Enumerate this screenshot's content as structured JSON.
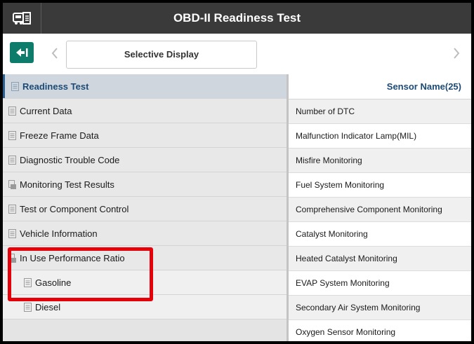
{
  "header": {
    "title": "OBD-II Readiness Test",
    "logo_icon": "car-document-icon"
  },
  "toolbar": {
    "exit_icon": "exit-arrow-icon",
    "prev_icon": "chevron-left-icon",
    "next_icon": "chevron-right-icon",
    "selective_display_label": "Selective Display"
  },
  "menu": {
    "items": [
      {
        "label": "Readiness Test",
        "icon": "document-icon",
        "active": true
      },
      {
        "label": "Current Data",
        "icon": "document-icon"
      },
      {
        "label": "Freeze Frame Data",
        "icon": "document-icon"
      },
      {
        "label": "Diagnostic Trouble Code",
        "icon": "document-icon"
      },
      {
        "label": "Monitoring Test Results",
        "icon": "folder-document-icon"
      },
      {
        "label": "Test or Component Control",
        "icon": "document-icon"
      },
      {
        "label": "Vehicle Information",
        "icon": "document-icon"
      },
      {
        "label": "In Use Performance Ratio",
        "icon": "folder-document-icon"
      },
      {
        "label": "Gasoline",
        "icon": "document-icon",
        "sub": true
      },
      {
        "label": "Diesel",
        "icon": "document-icon",
        "sub": true
      }
    ]
  },
  "sensors": {
    "header": "Sensor Name(25)",
    "rows": [
      "Number of DTC",
      "Malfunction Indicator Lamp(MIL)",
      "Misfire Monitoring",
      "Fuel System Monitoring",
      "Comprehensive Component Monitoring",
      "Catalyst Monitoring",
      "Heated Catalyst Monitoring",
      "EVAP System Monitoring",
      "Secondary Air System Monitoring",
      "Oxygen Sensor Monitoring"
    ]
  },
  "colors": {
    "header_bg": "#3a3a3a",
    "exit_button": "#0d7c6a",
    "active_text": "#1c4a76",
    "highlight_border": "#e5000a"
  }
}
